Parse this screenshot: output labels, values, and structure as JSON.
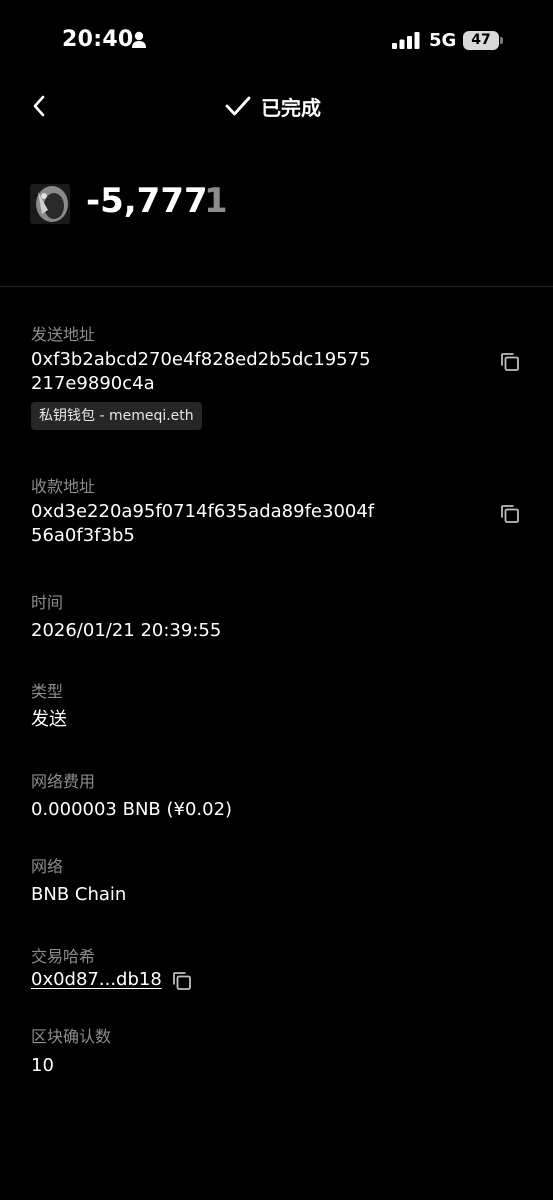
{
  "status_bar": {
    "time": "20:40",
    "network": "5G",
    "battery": "47"
  },
  "header": {
    "title": "已完成"
  },
  "amount": {
    "value": "-5,777",
    "suffix": "1"
  },
  "details": {
    "from_label": "发送地址",
    "from_line1": "0xf3b2abcd270e4f828ed2b5dc19575",
    "from_line2": "217e9890c4a",
    "wallet_tag": "私钥钱包 - memeqi.eth",
    "to_label": "收款地址",
    "to_line1": "0xd3e220a95f0714f635ada89fe3004f",
    "to_line2": "56a0f3f3b5",
    "time_label": "时间",
    "time_value": "2026/01/21 20:39:55",
    "type_label": "类型",
    "type_value": "发送",
    "fee_label": "网络费用",
    "fee_value": "0.000003 BNB (¥0.02)",
    "network_label": "网络",
    "network_value": "BNB Chain",
    "hash_label": "交易哈希",
    "hash_value": "0x0d87...db18",
    "confirm_label": "区块确认数",
    "confirm_value": "10"
  },
  "icons": [
    "person-icon",
    "signal-icon",
    "back-icon",
    "check-icon",
    "copy-icon"
  ]
}
